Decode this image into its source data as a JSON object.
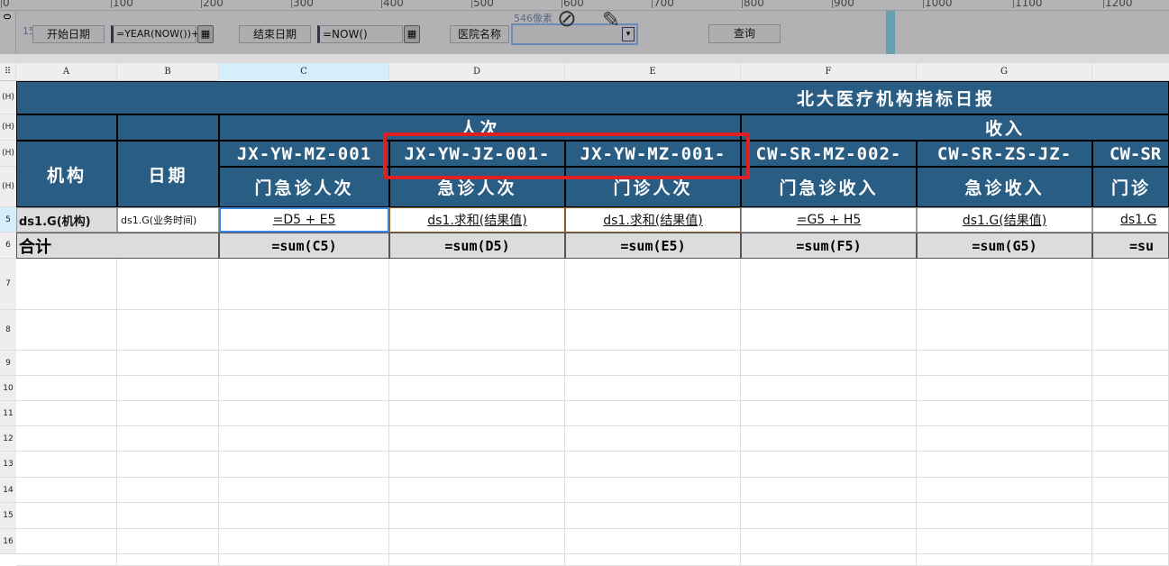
{
  "ruler": {
    "ticks": [
      "0",
      "100",
      "200",
      "300",
      "400",
      "500",
      "600",
      "700",
      "800",
      "900",
      "1000",
      "1100",
      "1200"
    ],
    "vertical": "0"
  },
  "toolbar": {
    "margin_hint": "15像素",
    "width_hint": "546像素",
    "start_date_label": "开始日期",
    "start_date_value": "=YEAR(NOW())+",
    "end_date_label": "结束日期",
    "end_date_value": "=NOW()",
    "hospital_label": "医院名称",
    "hospital_value": "",
    "query_button": "查询"
  },
  "columns": [
    "A",
    "B",
    "C",
    "D",
    "E",
    "F",
    "G"
  ],
  "row_headers": [
    "(H)",
    "(H)",
    "(H)",
    "(H)",
    "5",
    "6",
    "7",
    "8",
    "9",
    "10",
    "11",
    "12",
    "13",
    "14",
    "15",
    "16"
  ],
  "report": {
    "title": "北大医疗机构指标日报",
    "group_visits": "人次",
    "group_income": "收入",
    "col_org": "机构",
    "col_date": "日期",
    "codes": [
      "JX-YW-MZ-001",
      "JX-YW-JZ-001-",
      "JX-YW-MZ-001-",
      "CW-SR-MZ-002-",
      "CW-SR-ZS-JZ-",
      "CW-SR"
    ],
    "names": [
      "门急诊人次",
      "急诊人次",
      "门诊人次",
      "门急诊收入",
      "急诊收入",
      "门诊"
    ],
    "row5": [
      "ds1.G(机构)",
      "ds1.G(业务时间)",
      "=D5 + E5",
      "ds1.求和(结果值)",
      "ds1.求和(结果值)",
      "=G5 + H5",
      "ds1.G(结果值)",
      "ds1.G"
    ],
    "total_label": "合计",
    "totals": [
      "=sum(C5)",
      "=sum(D5)",
      "=sum(E5)",
      "=sum(F5)",
      "=sum(G5)",
      "=su"
    ]
  },
  "colors": {
    "header_bg": "#2a5d84",
    "highlight": "#e02020",
    "selection": "#3a86e0"
  }
}
